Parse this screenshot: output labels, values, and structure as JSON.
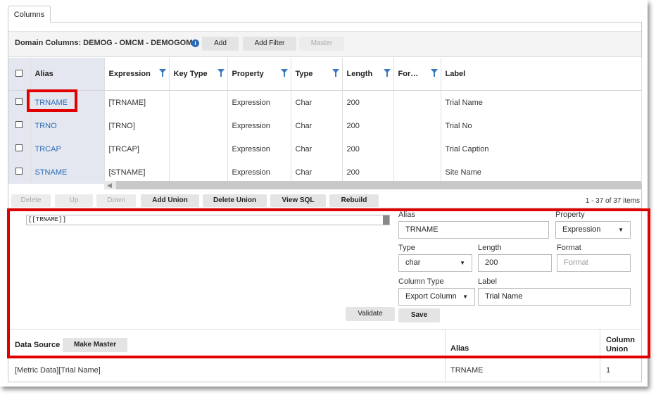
{
  "tabs": [
    {
      "label": "Columns"
    }
  ],
  "header": {
    "title": "Domain Columns: DEMOG - OMCM - DEMOGOMC",
    "buttons": {
      "add": "Add",
      "add_filter": "Add Filter",
      "master": "Master"
    }
  },
  "grid": {
    "columns": [
      "Alias",
      "Expression",
      "Key Type",
      "Property",
      "Type",
      "Length",
      "For…",
      "Label"
    ],
    "rows": [
      {
        "alias": "TRNAME",
        "expression": "[TRNAME]",
        "key_type": "",
        "property": "Expression",
        "type": "Char",
        "length": "200",
        "format": "",
        "label": "Trial Name"
      },
      {
        "alias": "TRNO",
        "expression": "[TRNO]",
        "key_type": "",
        "property": "Expression",
        "type": "Char",
        "length": "200",
        "format": "",
        "label": "Trial No"
      },
      {
        "alias": "TRCAP",
        "expression": "[TRCAP]",
        "key_type": "",
        "property": "Expression",
        "type": "Char",
        "length": "200",
        "format": "",
        "label": "Trial Caption"
      },
      {
        "alias": "STNAME",
        "expression": "[STNAME]",
        "key_type": "",
        "property": "Expression",
        "type": "Char",
        "length": "200",
        "format": "",
        "label": "Site Name"
      }
    ]
  },
  "toolbar": {
    "delete": "Delete",
    "up": "Up",
    "down": "Down",
    "add_union": "Add Union",
    "delete_union": "Delete Union",
    "view_sql": "View SQL",
    "rebuild": "Rebuild",
    "pager": "1 - 37 of 37 items"
  },
  "editor": {
    "sql_text": "[[TRNAME]]",
    "alias_label": "Alias",
    "alias_value": "TRNAME",
    "property_label": "Property",
    "property_value": "Expression",
    "type_label": "Type",
    "type_value": "char",
    "length_label": "Length",
    "length_value": "200",
    "format_label": "Format",
    "format_placeholder": "Format",
    "column_type_label": "Column Type",
    "column_type_value": "Export Column",
    "label_label": "Label",
    "label_value": "Trial Name",
    "validate": "Validate",
    "save": "Save"
  },
  "datasource": {
    "label": "Data Source",
    "make_master": "Make Master",
    "col_alias": "Alias",
    "col_union": "Column Union",
    "rows": [
      {
        "source": "[Metric Data][Trial Name]",
        "alias": "TRNAME",
        "union": "1"
      }
    ]
  }
}
